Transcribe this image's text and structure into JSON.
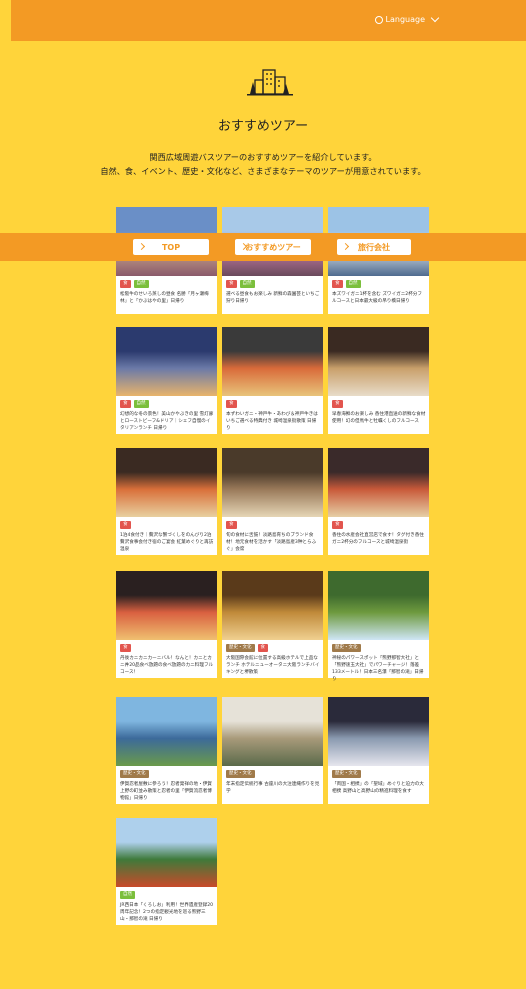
{
  "header": {
    "language_label": "Language"
  },
  "page": {
    "title": "おすすめツアー",
    "description_line1": "関西広域周遊バスツアーのおすすめツアーを紹介しています。",
    "description_line2": "自然、食、イベント、歴史・文化など、さまざまなテーマのツアーが用意されています。"
  },
  "breadcrumb": {
    "items": [
      {
        "label": "TOP"
      },
      {
        "label": "おすすめツアー"
      },
      {
        "label": "旅行会社"
      }
    ]
  },
  "colors": {
    "orange": "#f39a24",
    "yellow": "#ffd43a",
    "tag_food": "#e2554e",
    "tag_nature": "#7bbf3c",
    "tag_history": "#a07a4a"
  },
  "tours": [
    {
      "tags": [
        "食",
        "自然"
      ],
      "title": "松阪牛のせいろ蒸しの昼食 名勝「月ヶ瀬梅林」と「かぶはやの里」日帰り"
    },
    {
      "tags": [
        "食",
        "自然"
      ],
      "title": "選べる昼食もお楽しみ 新鮮の森園芸といちご狩り日帰り"
    },
    {
      "tags": [
        "食",
        "自然"
      ],
      "title": "本ズワイガニ1杯を含む ズワイガニ2杯分フルコースと日本最大級の吊り橋日帰り"
    },
    {
      "tags": [
        "食",
        "自然"
      ],
      "title": "幻想的な冬の景色！美山かやぶきの里 雪灯廊とローストビーフ&ドリア｜シェフ自慢のイタリアンランチ 日帰り"
    },
    {
      "tags": [
        "食"
      ],
      "title": "本ずわいガニ・神戸牛・あわび＆神戸牛きはいちご選べる特典付き 城崎温泉街散策 日帰り"
    },
    {
      "tags": [
        "食"
      ],
      "title": "早春海鮮のお楽しみ 香住港直送の新鮮な食材使用！幻の但馬牛と牡蠣くしのフルコース"
    },
    {
      "tags": [
        "食"
      ],
      "title": "1泊4食付き｜贅沢な蟹づくしをのんびり2泊贅沢食事会付き宿のご宴会 紅葉めぐりと再訪温泉"
    },
    {
      "tags": [
        "食"
      ],
      "title": "旬の食材に舌鼓！淡路島育ちのブランド食材！地元食材を活かす「淡路島産3种とらふぐ」会席"
    },
    {
      "tags": [
        "食"
      ],
      "title": "香住の水産会社直営店で食す！タグ付き香住ガニ2杯分のフルコースと城崎温泉街"
    },
    {
      "tags": [
        "食"
      ],
      "title": "丹後カニカニカーニバル！なんと！カニとカニ丼20品食べ放題の食べ放題のカニ料理フルコース！"
    },
    {
      "tags": [
        "歴史・文化",
        "食"
      ],
      "title": "大阪国際会館に位置する高級ホテルで上品なランチ ホテルニューオータニ大阪ランチバイキングと堺散策"
    },
    {
      "tags": [
        "歴史・文化"
      ],
      "title": "神秘のパワースポット「熊野那智大社」と「熊野速玉大社」でパワーチャージ！落差133メートル！日本三名瀑「那智の滝」日帰り"
    },
    {
      "tags": [
        "歴史・文化"
      ],
      "title": "伊賀忍者屋敷に参ろう！忍者発祥の地・伊賀上野の町並み散策と忍者の里「伊賀流忍者博物館」日帰り"
    },
    {
      "tags": [
        "歴史・文化"
      ],
      "title": "年末指定伝統行事 古座川の大注連縄作りを見学"
    },
    {
      "tags": [
        "歴史・文化"
      ],
      "title": "「両国・相撲」の「聖域」めぐりと迫力の大相撲 高野山と高野山の精進料理を食す"
    },
    {
      "tags": [
        "自然"
      ],
      "title": "JR西日本「くろしお」利用！世界遺産登録20周年記念！2つの指定観光地を巡る熊野三山・那智の滝 日帰り"
    }
  ]
}
